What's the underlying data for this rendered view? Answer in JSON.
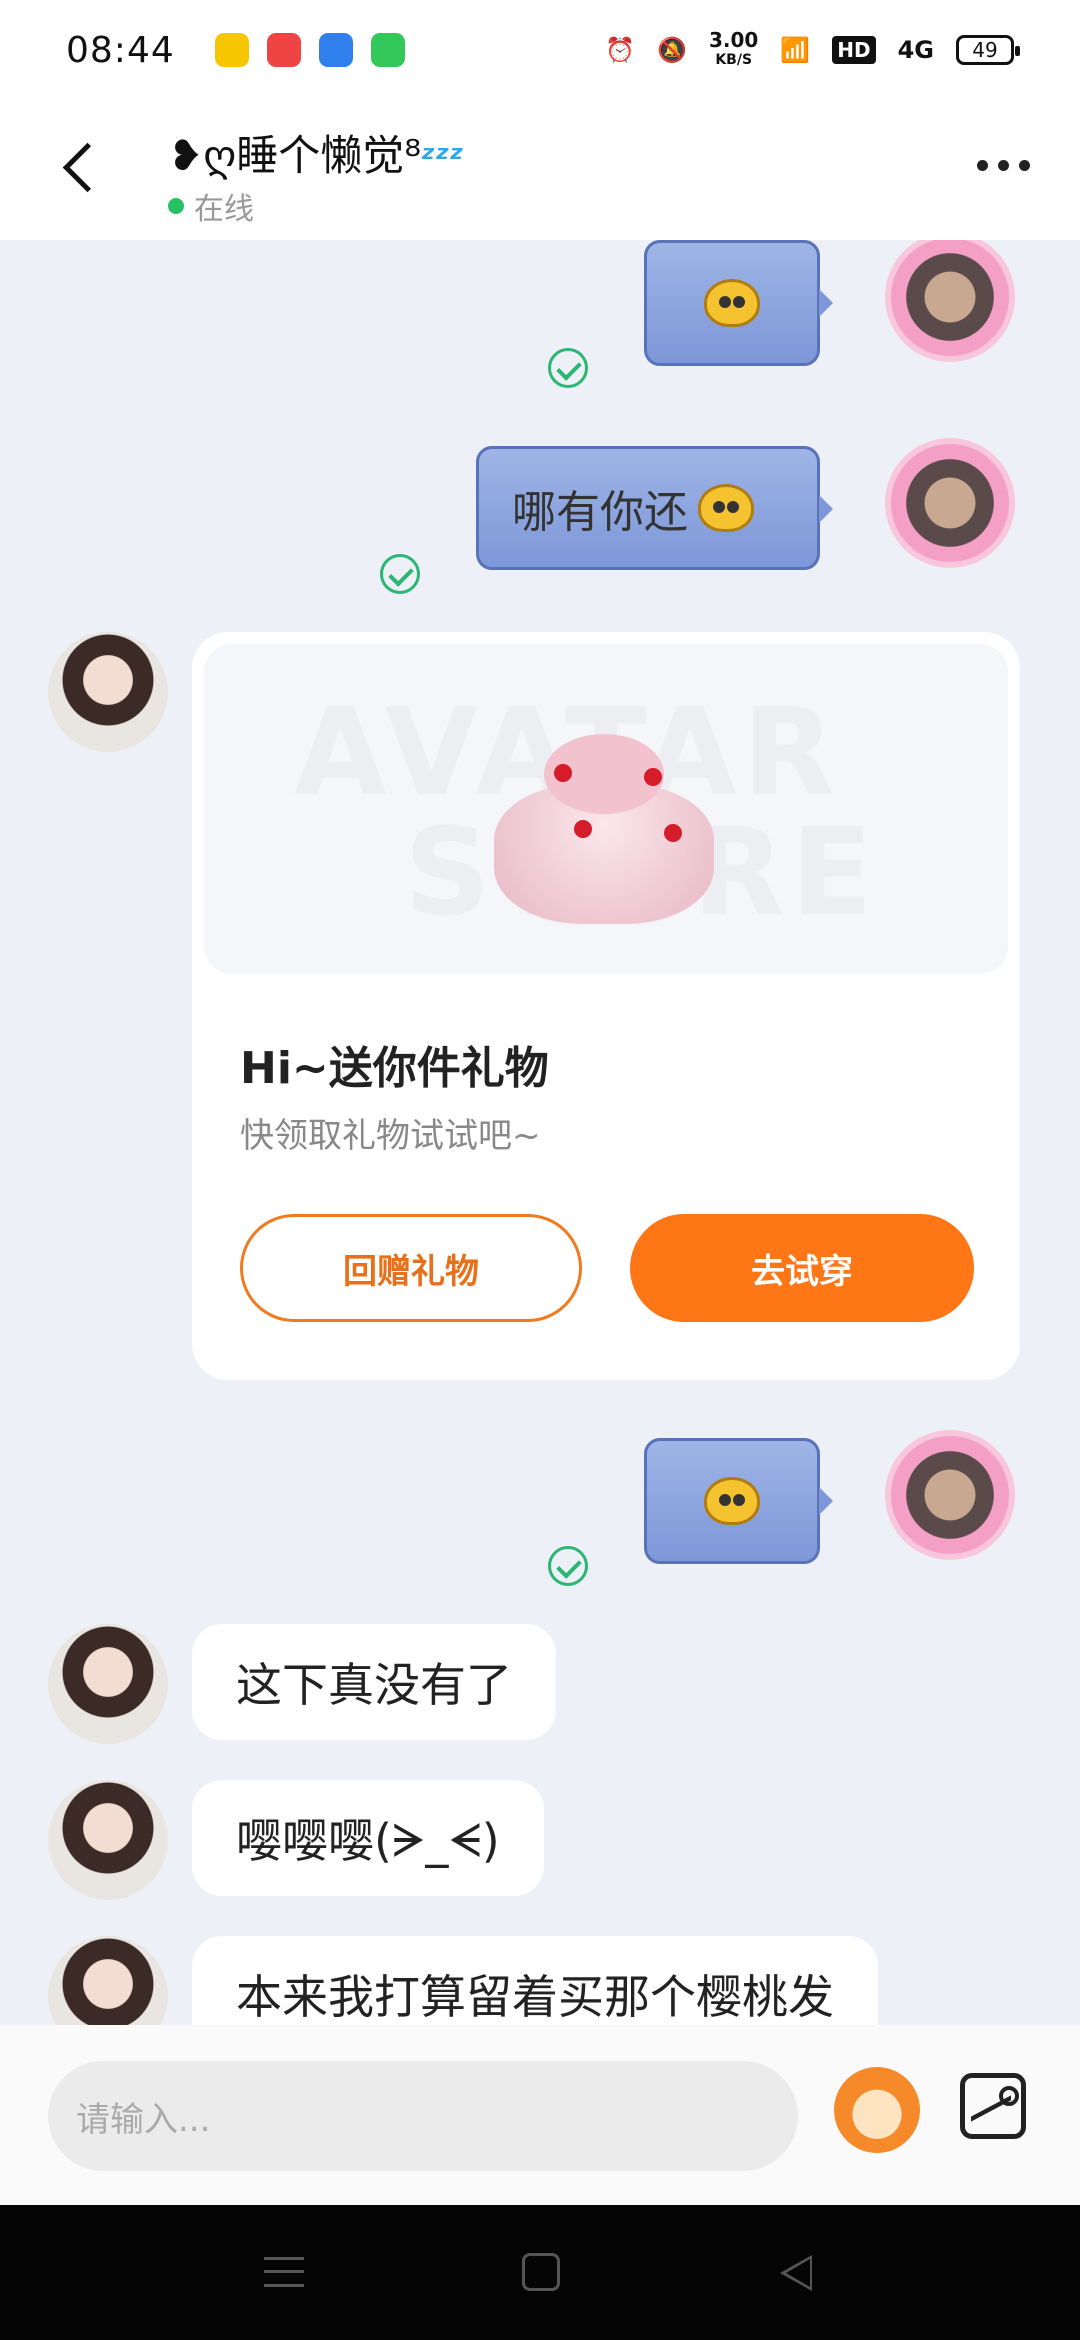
{
  "status_bar": {
    "time": "08:44",
    "net_speed_value": "3.00",
    "net_speed_unit": "KB/S",
    "hd": "HD",
    "net_type": "4G",
    "battery": "49",
    "app_icon_colors": [
      "#f6c700",
      "#ef4444",
      "#2f80ed",
      "#34c759"
    ]
  },
  "header": {
    "title": "❥ღ睡个懒觉⁸",
    "title_suffix": "ᶻᶻᶻ",
    "status": "在线",
    "online_color": "#25c163"
  },
  "gift_card": {
    "watermark_line1": "AVATAR",
    "watermark_line2": "STORE",
    "title": "Hi~送你件礼物",
    "subtitle": "快领取礼物试试吧~",
    "return_gift_label": "回赠礼物",
    "try_on_label": "去试穿",
    "accent_color": "#fe7616"
  },
  "messages": {
    "sent_text_1": "哪有你还",
    "recv_text_1": "这下真没有了",
    "recv_text_2": "嘤嘤嘤(ᗒ_ᗕ)",
    "recv_text_3": "本来我打算留着买那个樱桃发"
  },
  "input": {
    "placeholder": "请输入..."
  }
}
